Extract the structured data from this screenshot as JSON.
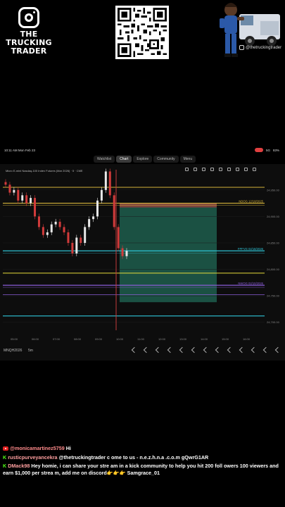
{
  "stream": {
    "logo_lines": [
      "THE",
      "TRUCKING",
      "TRADER"
    ],
    "social_handle": "@thetruckingtrader"
  },
  "phone": {
    "time": "10:11 AM  Mon Feb 23",
    "battery": "83%",
    "signal": "5G"
  },
  "tabs": [
    "Watchlist",
    "Chart",
    "Explore",
    "Community",
    "Menu"
  ],
  "chart": {
    "title": "Micro E-mini Nasdaq-100 Index Futures (Mar 2026) · 5 · CME",
    "symbol": "MNQH2026",
    "timeframe": "5m"
  },
  "chart_data": {
    "type": "line",
    "title": "Micro E-mini Nasdaq-100 Index Futures (Mar 2026) · 5 · CME",
    "x_ticks": [
      "05:00",
      "06:00",
      "07:00",
      "08:00",
      "09:00",
      "10:00",
      "11:00",
      "12:00",
      "13:00",
      "14:00",
      "15:00",
      "16:00"
    ],
    "y_ticks": [
      "24,950.00",
      "24,900.00",
      "24,850.00",
      "24,800.00",
      "24,750.00",
      "24,700.00"
    ],
    "levels": [
      {
        "name": "NDOG 12/18/2025",
        "value": 24925,
        "color": "#d4b33a"
      },
      {
        "name": "FPFVG 02/18/2026",
        "value": 24835,
        "color": "#2ec4d6"
      },
      {
        "name": "NWOG 02/10/2026",
        "value": 24770,
        "color": "#8a5cd6"
      }
    ],
    "series": [
      {
        "values": [
          24960,
          24945,
          24950,
          24930,
          24940,
          24925,
          24935,
          24900,
          24880,
          24865,
          24870,
          24885,
          24890,
          24880,
          24870,
          24850,
          24830,
          24860,
          24850,
          24880,
          24895,
          24900,
          24930,
          24950,
          24985,
          24940,
          24880,
          24840,
          24825,
          24835
        ]
      }
    ]
  },
  "chat": [
    {
      "platform": "youtube",
      "user": "@monicamartinez5759",
      "text": "Hi"
    },
    {
      "platform": "kick",
      "user": "rusticpurveyancekra",
      "text": "@thetruckingtrader c ome to us - n.e.z.h.n.a .c.o.m gQwrG1AR"
    },
    {
      "platform": "kick",
      "user": "DMack98",
      "text": "Hey homie, i can share your stre am in a kick community to help you hit 200 foll owers 100 viewers and earn $1,000 per strea m, add me on discord👉👉👉 Samgrace_01"
    }
  ]
}
